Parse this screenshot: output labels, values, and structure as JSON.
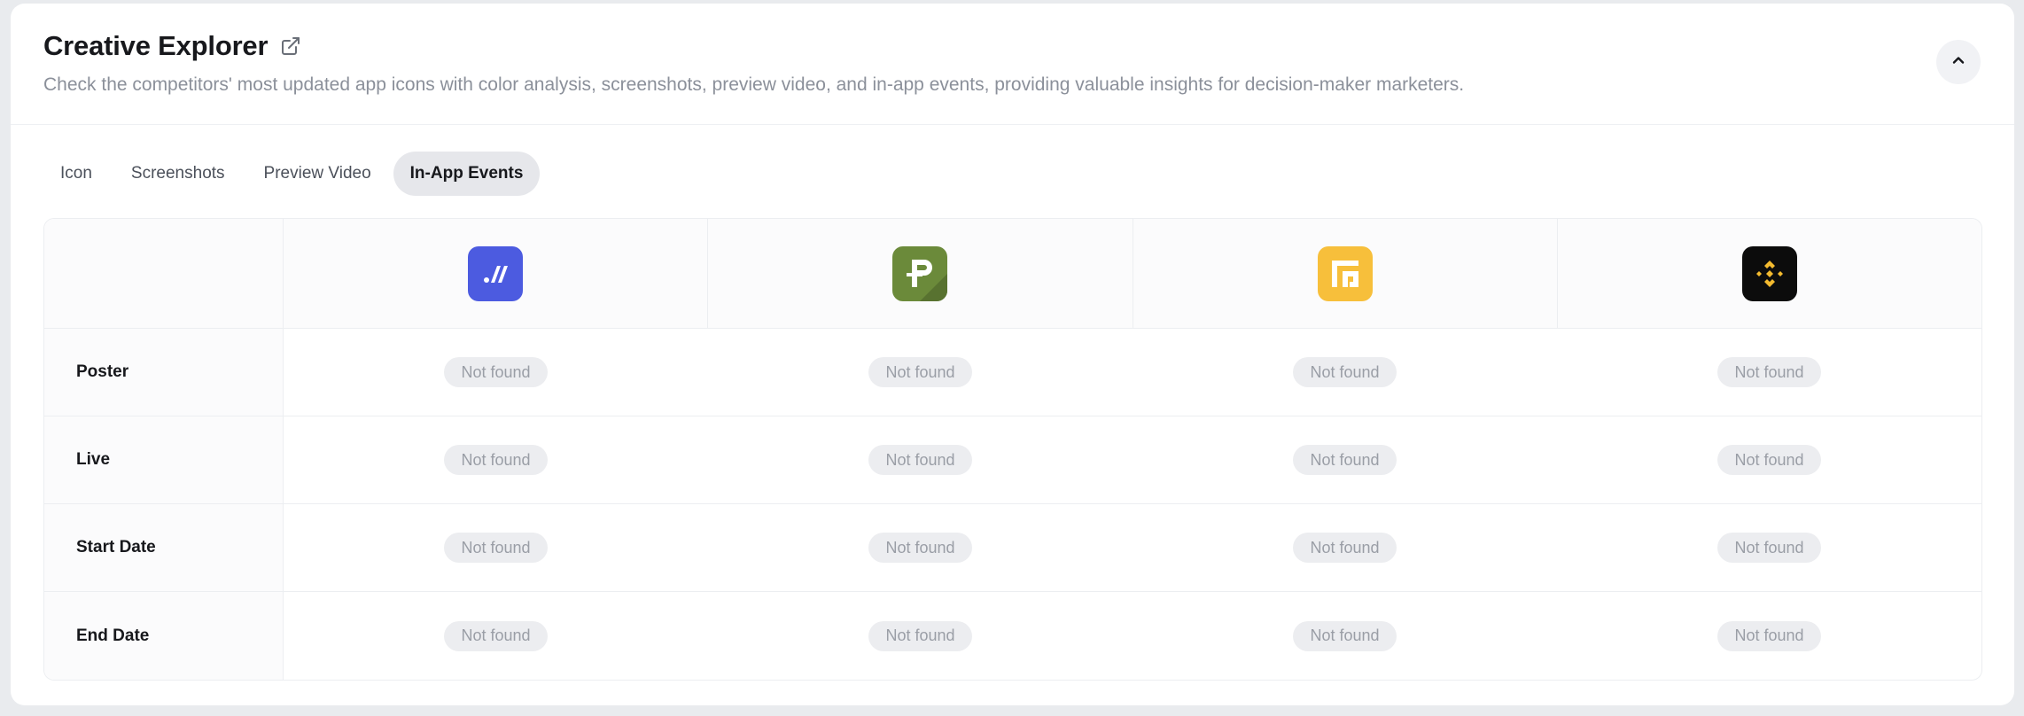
{
  "header": {
    "title": "Creative Explorer",
    "subtitle": "Check the competitors' most updated app icons with color analysis, screenshots, preview video, and in-app events, providing valuable insights for decision-maker marketers."
  },
  "tabs": [
    {
      "label": "Icon",
      "active": false
    },
    {
      "label": "Screenshots",
      "active": false
    },
    {
      "label": "Preview Video",
      "active": false
    },
    {
      "label": "In-App Events",
      "active": true
    }
  ],
  "apps": [
    {
      "icon": "mode-app-icon",
      "color": "#4c5be0"
    },
    {
      "icon": "p-app-icon",
      "color": "#6b8a3a"
    },
    {
      "icon": "g-app-icon",
      "color": "#f7bf3b"
    },
    {
      "icon": "binance-app-icon",
      "color": "#0c0c0c"
    }
  ],
  "rows": [
    {
      "label": "Poster",
      "values": [
        "Not found",
        "Not found",
        "Not found",
        "Not found"
      ]
    },
    {
      "label": "Live",
      "values": [
        "Not found",
        "Not found",
        "Not found",
        "Not found"
      ]
    },
    {
      "label": "Start Date",
      "values": [
        "Not found",
        "Not found",
        "Not found",
        "Not found"
      ]
    },
    {
      "label": "End Date",
      "values": [
        "Not found",
        "Not found",
        "Not found",
        "Not found"
      ]
    }
  ]
}
